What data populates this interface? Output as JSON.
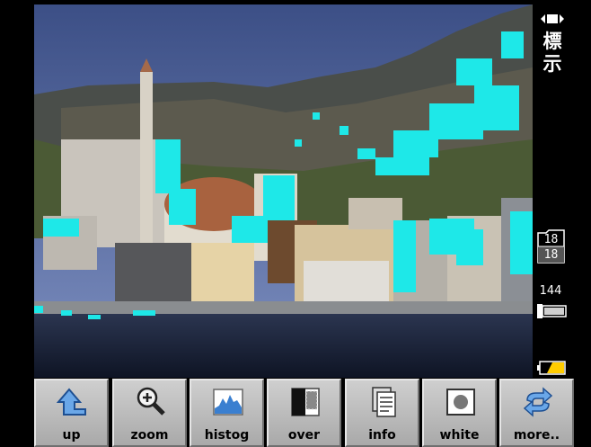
{
  "status": {
    "mode_label": "標示",
    "image_counter": {
      "current": "18",
      "total": "18"
    },
    "remaining_shots": "144"
  },
  "toolbar": {
    "buttons": [
      {
        "label": "up",
        "icon": "up-arrow-icon"
      },
      {
        "label": "zoom",
        "icon": "zoom-in-icon"
      },
      {
        "label": "histog",
        "icon": "histogram-icon"
      },
      {
        "label": "over",
        "icon": "overexposure-icon"
      },
      {
        "label": "info",
        "icon": "info-document-icon"
      },
      {
        "label": "white",
        "icon": "white-balance-icon"
      },
      {
        "label": "more..",
        "icon": "more-arrows-icon"
      }
    ]
  },
  "colors": {
    "overexposure_highlight": "#1ee8e8",
    "toolbar_button": "#bdbdbd",
    "battery_level": "#ffcc00",
    "icon_blue": "#3a7fd0"
  }
}
